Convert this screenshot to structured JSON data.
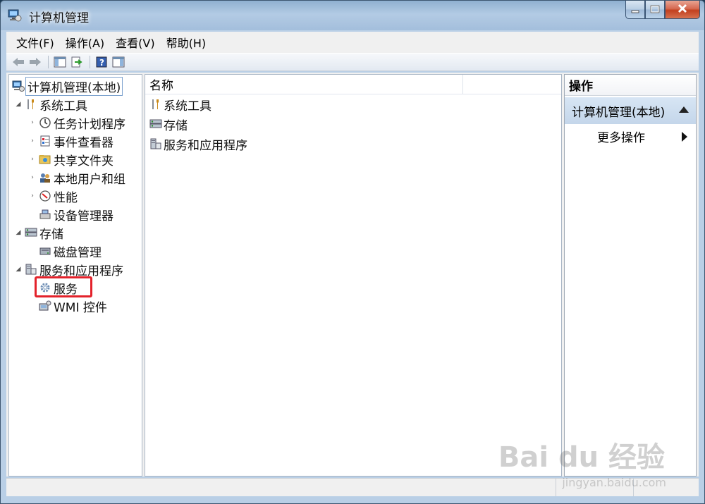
{
  "window": {
    "title": "计算机管理",
    "icon": "computer-management-icon"
  },
  "menu": [
    "文件(F)",
    "操作(A)",
    "查看(V)",
    "帮助(H)"
  ],
  "toolbar": [
    "back-arrow-icon",
    "forward-arrow-icon",
    "show-hide-tree-icon",
    "export-list-icon",
    "help-icon",
    "show-hide-action-pane-icon"
  ],
  "tree": {
    "root": "计算机管理(本地)",
    "system_tools": "系统工具",
    "task_scheduler": "任务计划程序",
    "event_viewer": "事件查看器",
    "shared_folders": "共享文件夹",
    "local_users": "本地用户和组",
    "performance": "性能",
    "device_manager": "设备管理器",
    "storage": "存储",
    "disk_management": "磁盘管理",
    "services_apps": "服务和应用程序",
    "services": "服务",
    "wmi": "WMI 控件"
  },
  "list": {
    "column_name": "名称",
    "items": [
      "系统工具",
      "存储",
      "服务和应用程序"
    ]
  },
  "actions": {
    "header": "操作",
    "section": "计算机管理(本地)",
    "more": "更多操作"
  },
  "watermark": {
    "logo": "Bai du 经验",
    "url": "jingyan.baidu.com"
  },
  "colors": {
    "highlight_box": "#e3222b",
    "actions_section_bg": "#c9daee",
    "selection_border": "#7da2ce"
  }
}
